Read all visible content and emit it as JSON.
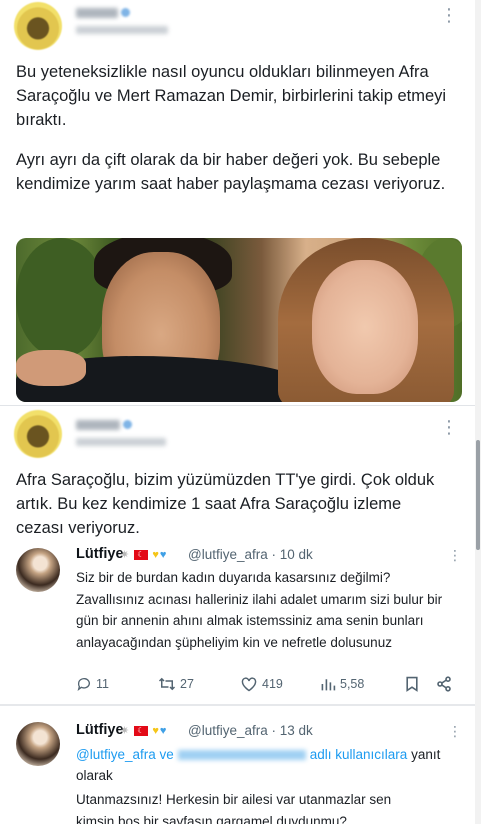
{
  "tweet1": {
    "text_p1": "Bu yeteneksizlikle nasıl oyuncu oldukları bilinmeyen Afra Saraçoğlu ve Mert Ramazan Demir, birbirlerini takip etmeyi bıraktı.",
    "text_p2": "Ayrı ayrı da çift olarak da bir haber değeri yok. Bu sebeple kendimize yarım saat haber paylaşmama cezası veriyoruz."
  },
  "tweet2": {
    "text": "Afra Saraçoğlu, bizim yüzümüzden TT'ye girdi. Çok olduk artık. Bu kez kendimize 1 saat Afra Saraçoğlu izleme cezası veriyoruz."
  },
  "reply1": {
    "name": "Lütfiye",
    "handle_time": "@lutfiye_afra · 10 dk",
    "text": "Siz bir de burdan  kadın duyarıda kasarsınız değilmi? Zavallısınız acınası halleriniz ilahi adalet umarım sizi bulur bir gün bir annenin ahını almak istemssiniz ama senin bunları anlayacağından şüpheliyim kin ve nefretle dolusunuz",
    "replies": "11",
    "retweets": "27",
    "likes": "419",
    "views": "5,58"
  },
  "reply2": {
    "name": "Lütfiye",
    "handle_time": "@lutfiye_afra · 13 dk",
    "mention": "@lutfiye_afra ve",
    "users_suffix": "adlı kullanıcılara",
    "yanit": "yanıt",
    "olarak": "olarak",
    "text": "Utanmazsınız! Herkesin bir ailesi var utanmazlar sen kimsin boş bir sayfasın gargamel duydunmu?"
  },
  "colors": {
    "link": "#1d9bf0",
    "muted": "#536471",
    "flag_red": "#e30a17"
  },
  "icons": [
    "more-icon",
    "reply-icon",
    "retweet-icon",
    "like-icon",
    "views-icon",
    "bookmark-icon",
    "share-icon"
  ]
}
